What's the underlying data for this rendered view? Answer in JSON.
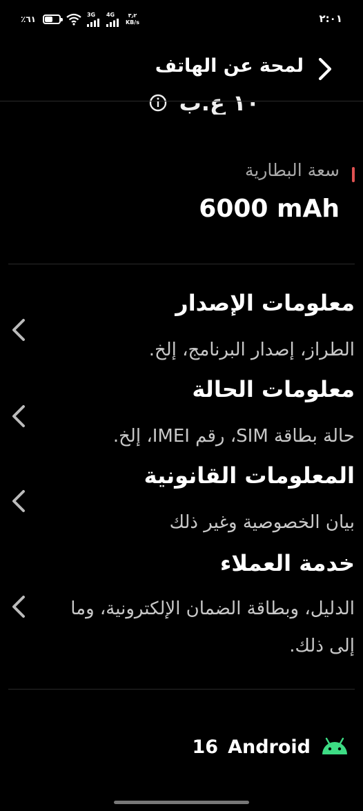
{
  "status_bar": {
    "time": "٢:٠١",
    "battery_percent": "٪٦١",
    "battery_level": 0.61,
    "network_1": "3G",
    "network_2": "4G",
    "speed_value": "٣٫٢",
    "speed_unit": "KB/s"
  },
  "header": {
    "title": "لمحة عن الهاتف",
    "back_icon": "chevron-right-icon"
  },
  "clipped_item": {
    "text": "١٠ ع.ب"
  },
  "battery": {
    "label": "سعة البطارية",
    "value": "6000 mAh",
    "accent_color": "#e05252"
  },
  "menu": {
    "items": [
      {
        "title": "معلومات الإصدار",
        "subtitle": "الطراز، إصدار البرنامج، إلخ."
      },
      {
        "title": "معلومات الحالة",
        "subtitle": "حالة بطاقة SIM، رقم IMEI، إلخ."
      },
      {
        "title": "المعلومات القانونية",
        "subtitle": "بيان الخصوصية وغير ذلك"
      },
      {
        "title": "خدمة العملاء",
        "subtitle": "الدليل، وبطاقة الضمان الإلكترونية، وما إلى ذلك."
      }
    ]
  },
  "android": {
    "label": "Android",
    "version": "16",
    "icon_color": "#3ddc84"
  }
}
